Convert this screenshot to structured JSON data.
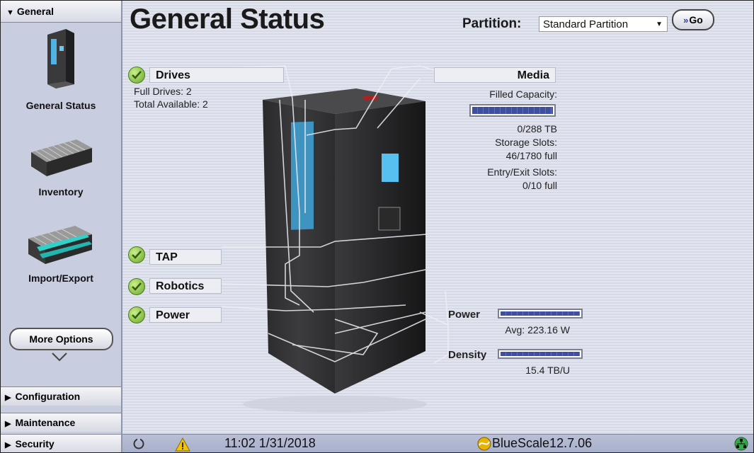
{
  "sidebar": {
    "header": "General",
    "items": [
      {
        "label": "General Status",
        "icon": "library-tower-icon"
      },
      {
        "label": "Inventory",
        "icon": "tape-stack-icon"
      },
      {
        "label": "Import/Export",
        "icon": "tape-import-export-icon"
      }
    ],
    "more_options": "More Options",
    "sections": [
      "Configuration",
      "Maintenance",
      "Security"
    ]
  },
  "main": {
    "title": "General Status",
    "partition_label": "Partition:",
    "partition_value": "Standard Partition",
    "go_label": "Go",
    "drives": {
      "label": "Drives",
      "full": "Full Drives: 2",
      "available": "Total Available: 2"
    },
    "media": {
      "label": "Media",
      "filled_capacity_label": "Filled Capacity:",
      "filled_capacity_value": "0/288 TB",
      "filled_fraction": 1.0,
      "storage_slots_label": "Storage Slots:",
      "storage_slots_value": "46/1780 full",
      "entry_exit_label": "Entry/Exit Slots:",
      "entry_exit_value": "0/10 full"
    },
    "tap_label": "TAP",
    "robotics_label": "Robotics",
    "power_status_label": "Power",
    "power_meter": {
      "label": "Power",
      "value": "Avg: 223.16 W",
      "fraction": 1.0
    },
    "density_meter": {
      "label": "Density",
      "value": "15.4 TB/U",
      "fraction": 1.0
    }
  },
  "status_bar": {
    "time": "11:02 1/31/2018",
    "version": "BlueScale12.7.06"
  },
  "colors": {
    "status_ok": "#6aa52a",
    "meter_fill": "#3f4f9e",
    "sidebar_bg": "#c9cde0",
    "warning": "#f2c400"
  }
}
